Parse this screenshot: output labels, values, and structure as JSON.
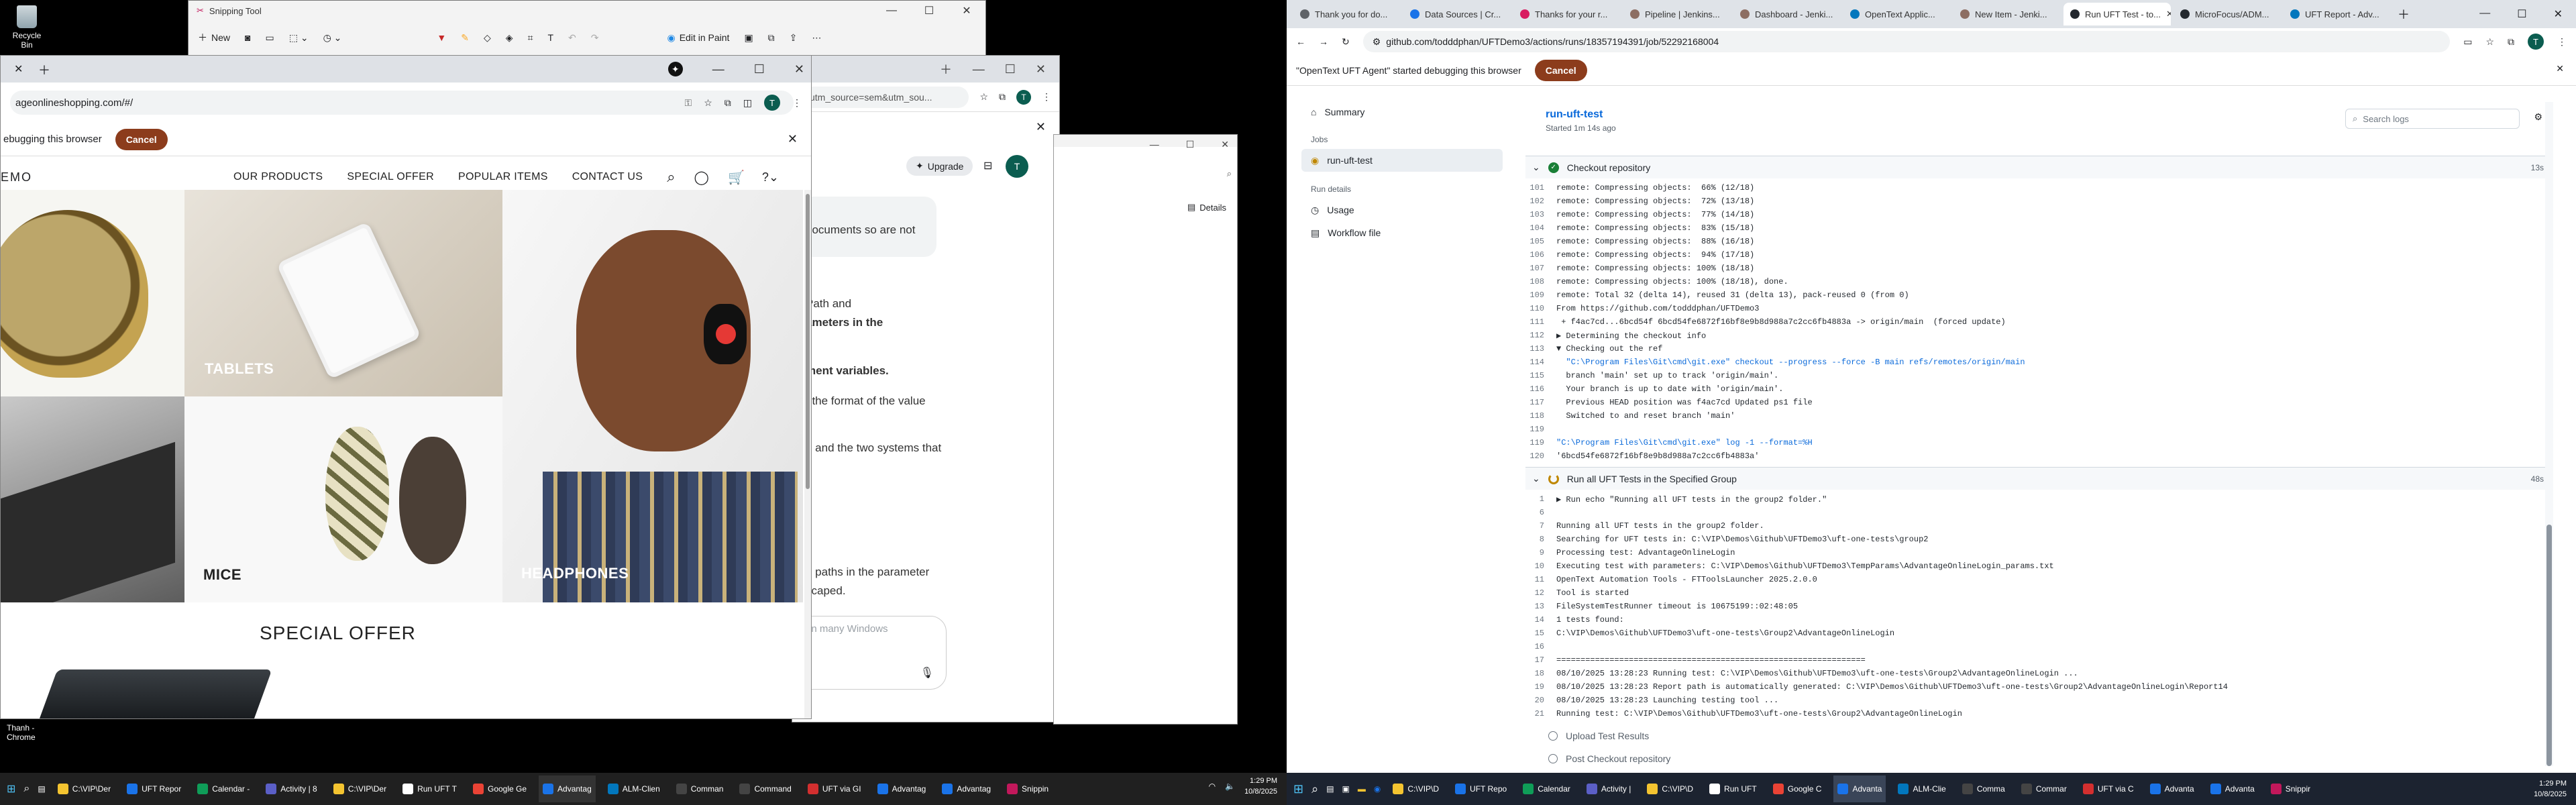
{
  "desktop": {
    "recycle_bin": "Recycle Bin",
    "chrome_shortcut": "Thanh - Chrome"
  },
  "snipping_tool": {
    "title": "Snipping Tool",
    "new_label": "New",
    "edit_in_paint": "Edit in Paint"
  },
  "left_browser": {
    "url": "ageonlineshopping.com/#/",
    "debug_text": "ebugging this browser",
    "cancel": "Cancel",
    "site_logo": "EMO",
    "nav": [
      "OUR PRODUCTS",
      "SPECIAL OFFER",
      "POPULAR ITEMS",
      "CONTACT US"
    ],
    "tiles": {
      "tablets": "TABLETS",
      "mice": "MICE",
      "headphones": "HEADPHONES"
    },
    "special_offer": "SPECIAL OFFER"
  },
  "back_browser": {
    "url": "utm_source=sem&utm_sou...",
    "upgrade": "Upgrade",
    "avatar": "T",
    "lines": [
      "documents so are not",
      "Path and",
      "ameters in the",
      "ment variables.",
      "t the format of the value",
      "g and the two systems that",
      "g paths in the parameter",
      "scaped."
    ],
    "input_placeholder": "in many Windows"
  },
  "details_window": {
    "details": "Details"
  },
  "right_browser": {
    "tabs": [
      "Thank you for do...",
      "Data Sources | Cr...",
      "Thanks for your r...",
      "Pipeline | Jenkins...",
      "Dashboard - Jenki...",
      "OpenText Applic...",
      "New Item - Jenki...",
      "Run UFT Test - to...",
      "MicroFocus/ADM...",
      "UFT Report - Adv..."
    ],
    "active_tab": 7,
    "url": "github.com/todddphan/UFTDemo3/actions/runs/18357194391/job/52292168004",
    "debug_text": "\"OpenText UFT Agent\" started debugging this browser",
    "cancel": "Cancel",
    "sidebar": {
      "summary": "Summary",
      "jobs_head": "Jobs",
      "job": "run-uft-test",
      "run_details_head": "Run details",
      "usage": "Usage",
      "workflow_file": "Workflow file"
    },
    "job_title": "run-uft-test",
    "job_subtitle": "Started 1m 14s ago",
    "search_placeholder": "Search logs",
    "step1": {
      "title": "Checkout repository",
      "duration": "13s"
    },
    "step1_lines": [
      [
        "101",
        "remote: Compressing objects:  66% (12/18)"
      ],
      [
        "102",
        "remote: Compressing objects:  72% (13/18)"
      ],
      [
        "103",
        "remote: Compressing objects:  77% (14/18)"
      ],
      [
        "104",
        "remote: Compressing objects:  83% (15/18)"
      ],
      [
        "105",
        "remote: Compressing objects:  88% (16/18)"
      ],
      [
        "106",
        "remote: Compressing objects:  94% (17/18)"
      ],
      [
        "107",
        "remote: Compressing objects: 100% (18/18)"
      ],
      [
        "108",
        "remote: Compressing objects: 100% (18/18), done."
      ],
      [
        "109",
        "remote: Total 32 (delta 14), reused 31 (delta 13), pack-reused 0 (from 0)"
      ],
      [
        "110",
        "From https://github.com/todddphan/UFTDemo3"
      ],
      [
        "111",
        " + f4ac7cd...6bcd54f 6bcd54fe6872f16bf8e9b8d988a7c2cc6fb4883a -> origin/main  (forced update)"
      ],
      [
        "112",
        "▶ Determining the checkout info"
      ],
      [
        "113",
        "▼ Checking out the ref"
      ],
      [
        "114",
        "  \"C:\\Program Files\\Git\\cmd\\git.exe\" checkout --progress --force -B main refs/remotes/origin/main"
      ],
      [
        "115",
        "  branch 'main' set up to track 'origin/main'."
      ],
      [
        "116",
        "  Your branch is up to date with 'origin/main'."
      ],
      [
        "117",
        "  Previous HEAD position was f4ac7cd Updated ps1 file"
      ],
      [
        "118",
        "  Switched to and reset branch 'main'"
      ],
      [
        "119",
        ""
      ],
      [
        "119",
        "\"C:\\Program Files\\Git\\cmd\\git.exe\" log -1 --format=%H"
      ],
      [
        "120",
        "'6bcd54fe6872f16bf8e9b8d988a7c2cc6fb4883a'"
      ]
    ],
    "step2": {
      "title": "Run all UFT Tests in the Specified Group",
      "duration": "48s"
    },
    "step2_lines": [
      [
        "1",
        "▶ Run echo \"Running all UFT tests in the group2 folder.\""
      ],
      [
        "6",
        ""
      ],
      [
        "7",
        "Running all UFT tests in the group2 folder."
      ],
      [
        "8",
        "Searching for UFT tests in: C:\\VIP\\Demos\\Github\\UFTDemo3\\uft-one-tests\\group2"
      ],
      [
        "9",
        "Processing test: AdvantageOnlineLogin"
      ],
      [
        "10",
        "Executing test with parameters: C:\\VIP\\Demos\\Github\\UFTDemo3\\TempParams\\AdvantageOnlineLogin_params.txt"
      ],
      [
        "11",
        "OpenText Automation Tools - FTToolsLauncher 2025.2.0.0"
      ],
      [
        "12",
        "Tool is started"
      ],
      [
        "13",
        "FileSystemTestRunner timeout is 10675199::02:48:05"
      ],
      [
        "14",
        "1 tests found:"
      ],
      [
        "15",
        "C:\\VIP\\Demos\\Github\\UFTDemo3\\uft-one-tests\\Group2\\AdvantageOnlineLogin"
      ],
      [
        "16",
        ""
      ],
      [
        "17",
        "================================================================"
      ],
      [
        "18",
        "08/10/2025 13:28:23 Running test: C:\\VIP\\Demos\\Github\\UFTDemo3\\uft-one-tests\\Group2\\AdvantageOnlineLogin ..."
      ],
      [
        "19",
        "08/10/2025 13:28:23 Report path is automatically generated: C:\\VIP\\Demos\\Github\\UFTDemo3\\uft-one-tests\\Group2\\AdvantageOnlineLogin\\Report14"
      ],
      [
        "20",
        "08/10/2025 13:28:23 Launching testing tool ..."
      ],
      [
        "21",
        "Running test: C:\\VIP\\Demos\\Github\\UFTDemo3\\uft-one-tests\\Group2\\AdvantageOnlineLogin"
      ]
    ],
    "pending_steps": [
      "Upload Test Results",
      "Post Checkout repository"
    ]
  },
  "taskbar_left": {
    "items": [
      "C:\\VIP\\Der",
      "UFT Repor",
      "Calendar -",
      "Activity | 8",
      "C:\\VIP\\Der",
      "Run UFT T",
      "Google Ge",
      "Advantag",
      "ALM-Clien",
      "Comman",
      "Command",
      "UFT via GI",
      "Advantag",
      "Advantag",
      "Snippin"
    ],
    "time": "1:29 PM",
    "date": "10/8/2025"
  },
  "taskbar_right": {
    "items": [
      "C:\\VIP\\D",
      "UFT Repo",
      "Calendar",
      "Activity |",
      "C:\\VIP\\D",
      "Run UFT",
      "Google C",
      "Advanta",
      "ALM-Clie",
      "Comma",
      "Commar",
      "UFT via C",
      "Advanta",
      "Advanta",
      "Snippir"
    ],
    "time": "1:29 PM",
    "date": "10/8/2025"
  }
}
